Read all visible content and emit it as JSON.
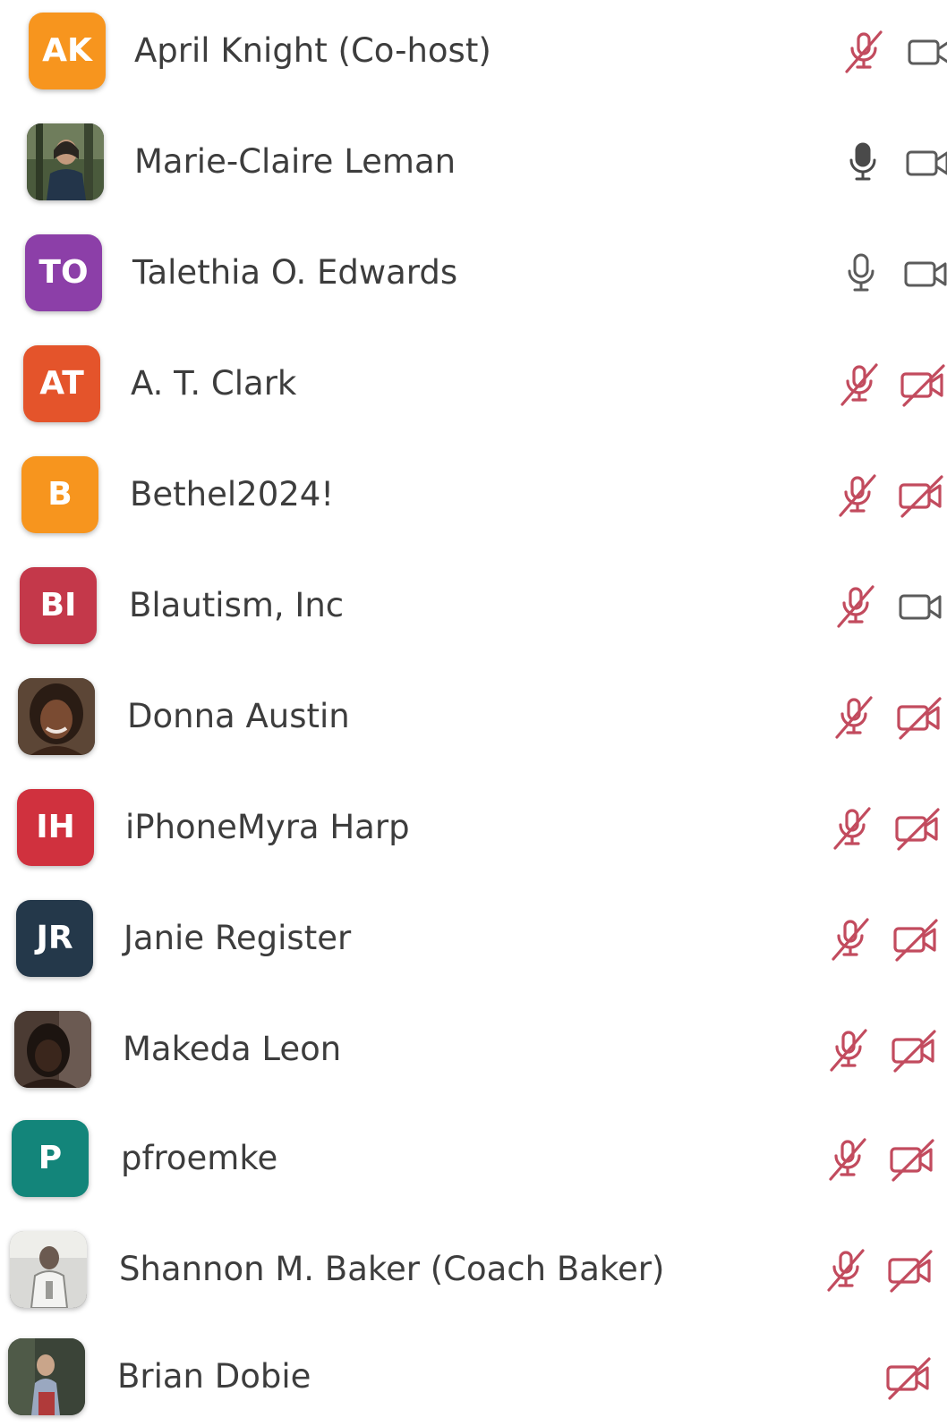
{
  "participants": [
    {
      "name": "April Knight (Co-host)",
      "initials": "AK",
      "avatar_color": "#F7951E",
      "mic": "muted",
      "video": "on"
    },
    {
      "name": "Marie-Claire Leman",
      "initials": "",
      "avatar_type": "photo",
      "mic": "on",
      "video": "on"
    },
    {
      "name": "Talethia O. Edwards",
      "initials": "TO",
      "avatar_color": "#8C3FA8",
      "mic": "on",
      "video": "on"
    },
    {
      "name": "A. T. Clark",
      "initials": "AT",
      "avatar_color": "#E4542B",
      "mic": "muted",
      "video": "off"
    },
    {
      "name": "Bethel2024!",
      "initials": "B",
      "avatar_color": "#F7951E",
      "mic": "muted",
      "video": "off"
    },
    {
      "name": "Blautism, Inc",
      "initials": "BI",
      "avatar_color": "#C4384A",
      "mic": "muted",
      "video": "on"
    },
    {
      "name": "Donna Austin",
      "initials": "",
      "avatar_type": "photo",
      "mic": "muted",
      "video": "off"
    },
    {
      "name": "iPhoneMyra Harp",
      "initials": "IH",
      "avatar_color": "#D0313E",
      "mic": "muted",
      "video": "off"
    },
    {
      "name": "Janie Register",
      "initials": "JR",
      "avatar_color": "#24384A",
      "mic": "muted",
      "video": "off"
    },
    {
      "name": "Makeda Leon",
      "initials": "",
      "avatar_type": "photo",
      "mic": "muted",
      "video": "off"
    },
    {
      "name": "pfroemke",
      "initials": "P",
      "avatar_color": "#13857A",
      "mic": "muted",
      "video": "off"
    },
    {
      "name": "Shannon M. Baker (Coach Baker)",
      "initials": "",
      "avatar_type": "photo",
      "mic": "muted",
      "video": "off"
    },
    {
      "name": "Brian Dobie",
      "initials": "",
      "avatar_type": "photo",
      "mic": "none",
      "video": "off"
    }
  ],
  "colors": {
    "muted_red": "#C24B5E",
    "icon_gray": "#5b5b5b",
    "name_text": "#3d3d3d"
  }
}
